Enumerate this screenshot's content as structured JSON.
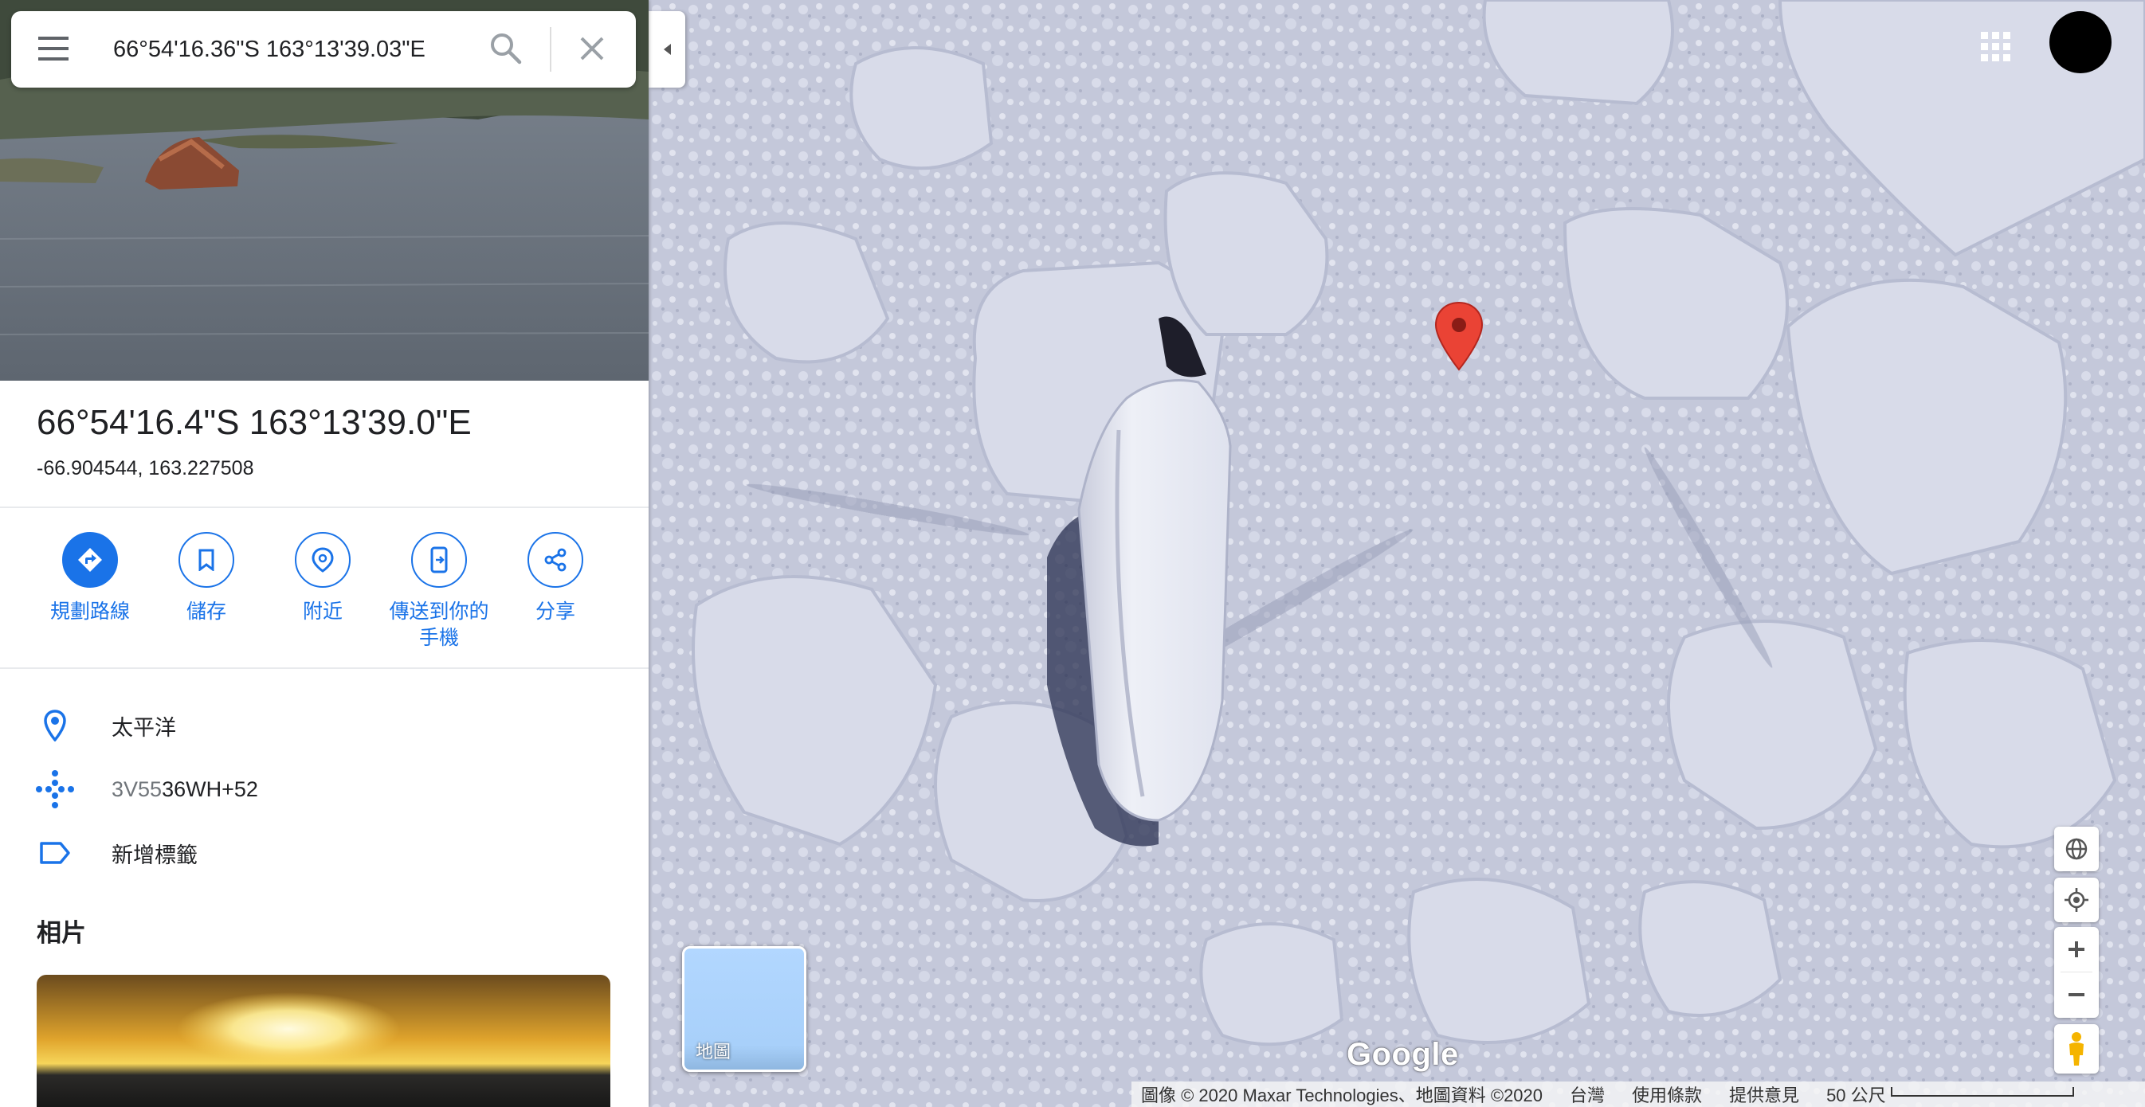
{
  "search": {
    "query": "66°54'16.36\"S 163°13'39.03\"E"
  },
  "place": {
    "title": "66°54'16.4\"S 163°13'39.0\"E",
    "decimal": "-66.904544, 163.227508"
  },
  "actions": [
    {
      "label": "規劃路線",
      "icon": "directions-icon"
    },
    {
      "label": "儲存",
      "icon": "bookmark-icon"
    },
    {
      "label": "附近",
      "icon": "nearby-icon"
    },
    {
      "label": "傳送到你的\n手機",
      "icon": "send-to-phone-icon"
    },
    {
      "label": "分享",
      "icon": "share-icon"
    }
  ],
  "info": {
    "location": "太平洋",
    "pluscode_prefix": "3V55",
    "pluscode_rest": "36WH+52",
    "add_label": "新增標籤"
  },
  "photos": {
    "heading": "相片"
  },
  "map": {
    "layer_label": "地圖",
    "logo": "Google",
    "footer": {
      "imagery": "圖像 © 2020 Maxar Technologies、地圖資料 ©2020",
      "region": "台灣",
      "terms": "使用條款",
      "feedback": "提供意見",
      "scale": "50 公尺"
    },
    "pin_color": "#ea4335",
    "accent": "#1a73e8"
  }
}
